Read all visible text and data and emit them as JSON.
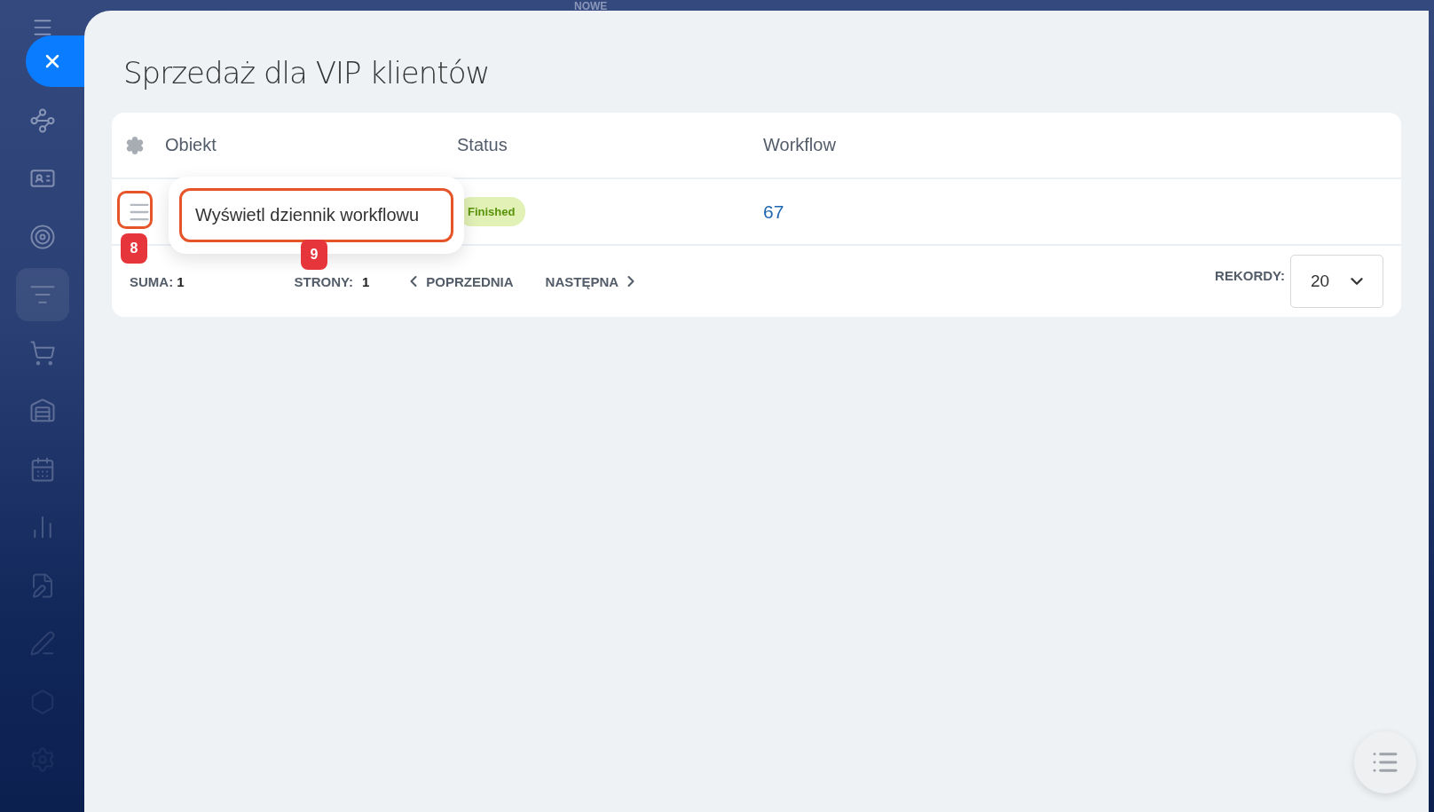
{
  "top_label": "NOWE",
  "sidebar": {
    "items": [
      {
        "kind": "flow",
        "selected": false
      },
      {
        "kind": "card",
        "selected": false
      },
      {
        "kind": "target",
        "selected": false
      },
      {
        "kind": "funnel",
        "selected": true
      },
      {
        "kind": "cart",
        "selected": false
      },
      {
        "kind": "store",
        "selected": false
      },
      {
        "kind": "calendar",
        "selected": false
      },
      {
        "kind": "chart",
        "selected": false
      },
      {
        "kind": "document",
        "selected": false
      },
      {
        "kind": "pen",
        "selected": false
      },
      {
        "kind": "hexagon",
        "selected": false
      },
      {
        "kind": "settings",
        "selected": false
      }
    ]
  },
  "title": "Sprzedaż dla VIP klientów",
  "table": {
    "columns": [
      "Obiekt",
      "Status",
      "Workflow"
    ],
    "rows": [
      {
        "status": "Finished",
        "workflow": "67"
      }
    ]
  },
  "context_menu": {
    "items": [
      "Wyświetl dziennik workflowu"
    ]
  },
  "annotations": [
    {
      "label": "8"
    },
    {
      "label": "9"
    }
  ],
  "footer": {
    "total_label": "SUMA:",
    "total": "1",
    "pages_label": "STRONY:",
    "pages": "1",
    "prev": "POPRZEDNIA",
    "next": "NASTĘPNA",
    "records_label": "REKORDY:",
    "records": "20"
  }
}
